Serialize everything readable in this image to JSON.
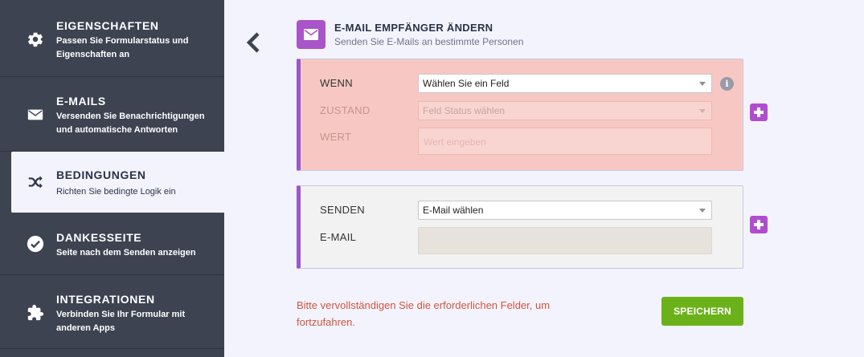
{
  "sidebar": {
    "items": [
      {
        "icon": "gear-icon",
        "title": "EIGENSCHAFTEN",
        "desc": "Passen Sie Formularstatus und Eigenschaften an"
      },
      {
        "icon": "envelope-icon",
        "title": "E-MAILS",
        "desc": "Versenden Sie Benachrichtigungen und automatische Antworten"
      },
      {
        "icon": "shuffle-icon",
        "title": "BEDINGUNGEN",
        "desc": "Richten Sie bedingte Logik ein",
        "active": true
      },
      {
        "icon": "check-circle-icon",
        "title": "DANKESSEITE",
        "desc": "Seite nach dem Senden anzeigen"
      },
      {
        "icon": "puzzle-icon",
        "title": "INTEGRATIONEN",
        "desc": "Verbinden Sie Ihr Formular mit anderen Apps"
      }
    ]
  },
  "header": {
    "icon": "envelope-icon",
    "title": "E-MAIL EMPFÄNGER ÄNDERN",
    "subtitle": "Senden Sie E-Mails an bestimmte Personen"
  },
  "condition": {
    "if_label": "WENN",
    "field_select": "Wählen Sie ein Feld",
    "state_label": "ZUSTAND",
    "state_select": "Feld Status wählen",
    "value_label": "WERT",
    "value_placeholder": "Wert eingeben"
  },
  "action": {
    "send_label": "SENDEN",
    "email_select": "E-Mail wählen",
    "email_label": "E-MAIL",
    "email_value": ""
  },
  "info_glyph": "i",
  "footer": {
    "error": "Bitte vervollständigen Sie die erforderlichen Felder, um fortzufahren.",
    "save_label": "SPEICHERN"
  },
  "colors": {
    "sidebar_bg": "#3e4352",
    "accent_purple": "#a954c8",
    "condition_bg": "#f7c8c3",
    "save_green": "#6bb21a",
    "error_red": "#d0563c"
  }
}
